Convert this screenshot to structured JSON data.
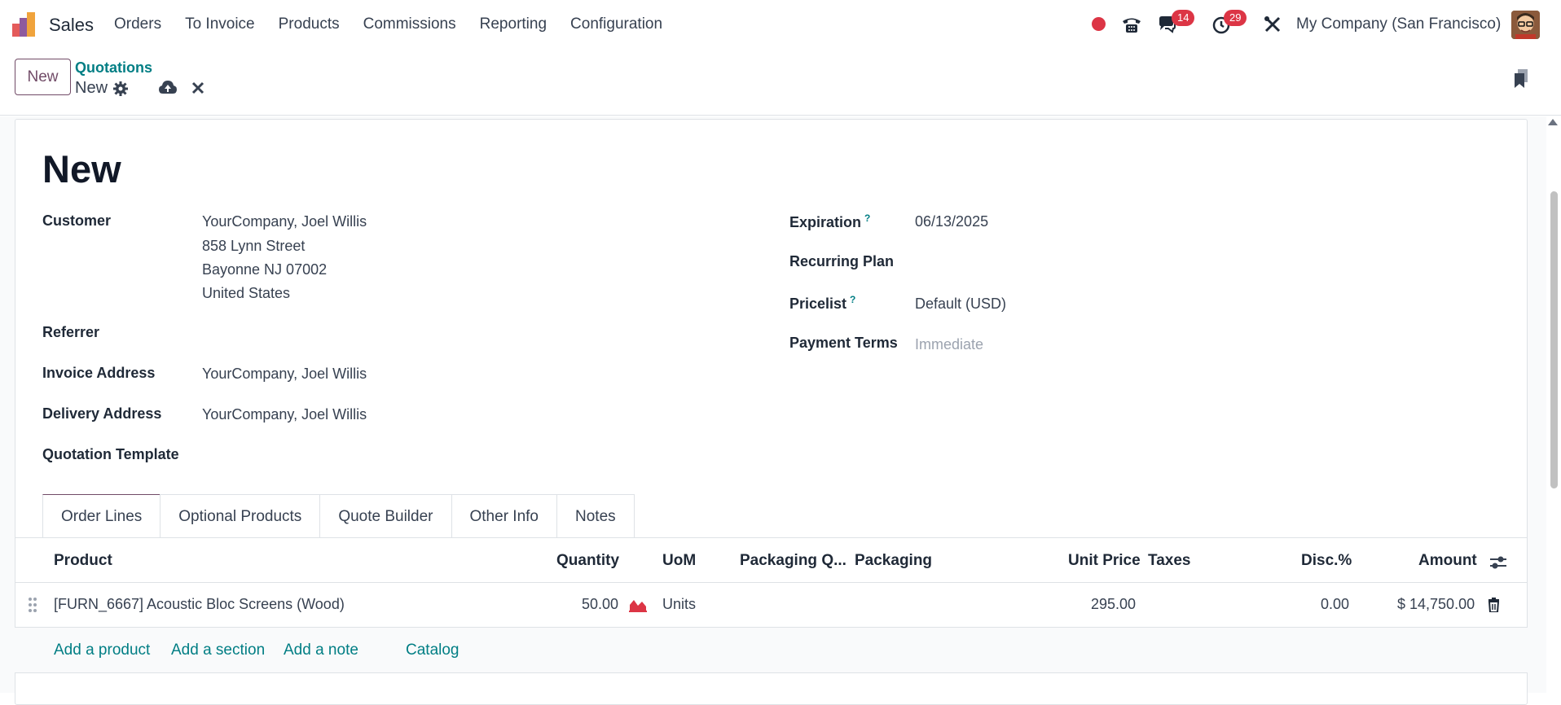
{
  "navbar": {
    "app_name": "Sales",
    "menu": [
      "Orders",
      "To Invoice",
      "Products",
      "Commissions",
      "Reporting",
      "Configuration"
    ],
    "messages_count": "14",
    "activities_count": "29",
    "company": "My Company (San Francisco)"
  },
  "control": {
    "new_label": "New",
    "breadcrumb_parent": "Quotations",
    "breadcrumb_current": "New"
  },
  "form": {
    "title": "New",
    "left": {
      "customer_label": "Customer",
      "customer_lines": [
        "YourCompany, Joel Willis",
        "858 Lynn Street",
        "Bayonne NJ 07002",
        "United States"
      ],
      "referrer_label": "Referrer",
      "invoice_address_label": "Invoice Address",
      "invoice_address_value": "YourCompany, Joel Willis",
      "delivery_address_label": "Delivery Address",
      "delivery_address_value": "YourCompany, Joel Willis",
      "quotation_template_label": "Quotation Template"
    },
    "right": {
      "expiration_label": "Expiration",
      "expiration_help": "?",
      "expiration_value": "06/13/2025",
      "recurring_plan_label": "Recurring Plan",
      "pricelist_label": "Pricelist",
      "pricelist_help": "?",
      "pricelist_value": "Default (USD)",
      "payment_terms_label": "Payment Terms",
      "payment_terms_placeholder": "Immediate"
    }
  },
  "tabs": [
    "Order Lines",
    "Optional Products",
    "Quote Builder",
    "Other Info",
    "Notes"
  ],
  "table": {
    "headers": {
      "product": "Product",
      "quantity": "Quantity",
      "uom": "UoM",
      "packaging_qty": "Packaging Q...",
      "packaging": "Packaging",
      "unit_price": "Unit Price",
      "taxes": "Taxes",
      "discount": "Disc.%",
      "amount": "Amount"
    },
    "rows": [
      {
        "product": "[FURN_6667] Acoustic Bloc Screens (Wood)",
        "quantity": "50.00",
        "uom": "Units",
        "unit_price": "295.00",
        "discount": "0.00",
        "amount": "$ 14,750.00"
      }
    ],
    "actions": [
      "Add a product",
      "Add a section",
      "Add a note",
      "Catalog"
    ]
  },
  "colors": {
    "brand": "#714b67",
    "link": "#017e84",
    "danger": "#dc3545"
  }
}
